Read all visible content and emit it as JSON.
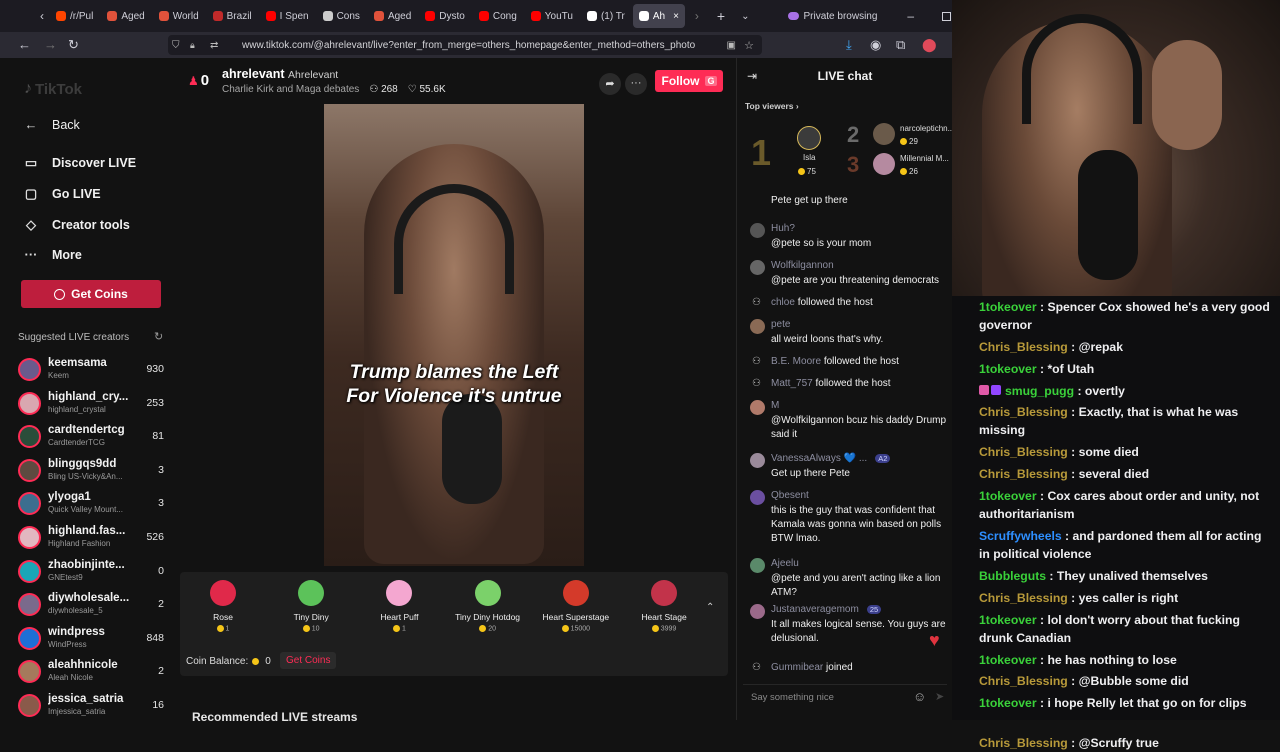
{
  "browser": {
    "tabs": [
      {
        "label": "/r/Pul",
        "color": "#ff4500"
      },
      {
        "label": "Aged",
        "color": "#e0523b"
      },
      {
        "label": "World",
        "color": "#e0523b"
      },
      {
        "label": "Brazil",
        "color": "#c02a2a"
      },
      {
        "label": "I Spen",
        "color": "#ff0000"
      },
      {
        "label": "Cons",
        "color": "#cccccc"
      },
      {
        "label": "Aged",
        "color": "#e0523b"
      },
      {
        "label": "Dysto",
        "color": "#ff0000"
      },
      {
        "label": "Cong",
        "color": "#ff0000"
      },
      {
        "label": "YouTu",
        "color": "#ff0000"
      },
      {
        "label": "(1) Tr",
        "color": "#ffffff"
      },
      {
        "label": "Ah",
        "color": "#ffffff"
      }
    ],
    "private_label": "Private browsing",
    "url": "www.tiktok.com/@ahrelevant/live?enter_from_merge=others_homepage&enter_method=others_photo"
  },
  "sidebar": {
    "logo": "TikTok",
    "back": "Back",
    "items": [
      {
        "label": "Discover LIVE",
        "icon": "tv-icon"
      },
      {
        "label": "Go LIVE",
        "icon": "camera-icon"
      },
      {
        "label": "Creator tools",
        "icon": "lightbulb-icon"
      },
      {
        "label": "More",
        "icon": "more-icon"
      }
    ],
    "get_coins": "Get Coins",
    "suggested_title": "Suggested LIVE creators",
    "creators": [
      {
        "name": "keemsama",
        "sub": "Keem",
        "count": "930",
        "color": "#6a5a8c"
      },
      {
        "name": "highland_cry...",
        "sub": "highland_crystal",
        "count": "253",
        "color": "#d9a7b0"
      },
      {
        "name": "cardtendertcg",
        "sub": "CardtenderTCG",
        "count": "81",
        "color": "#2a4d3a"
      },
      {
        "name": "blinggqs9dd",
        "sub": "Bling US-Vicky&An...",
        "count": "3",
        "color": "#5d4a40"
      },
      {
        "name": "ylyoga1",
        "sub": "Quick Valley Mount...",
        "count": "3",
        "color": "#3c6e8f"
      },
      {
        "name": "highland.fas...",
        "sub": "Highland Fashion",
        "count": "526",
        "color": "#e2b7c0"
      },
      {
        "name": "zhaobinjinte...",
        "sub": "GNEtest9",
        "count": "0",
        "color": "#1aa6b7"
      },
      {
        "name": "diywholesale...",
        "sub": "diywholesale_5",
        "count": "2",
        "color": "#7a6a8c"
      },
      {
        "name": "windpress",
        "sub": "WindPress",
        "count": "848",
        "color": "#1d6fd6"
      },
      {
        "name": "aleahhnicole",
        "sub": "Aleah Nicole",
        "count": "2",
        "color": "#a57a5c"
      },
      {
        "name": "jessica_satria",
        "sub": "Imjessica_satria",
        "count": "16",
        "color": "#8a5a4a"
      }
    ]
  },
  "live": {
    "rank": "0",
    "username": "ahrelevant",
    "display_name": "Ahrelevant",
    "topic": "Charlie Kirk and Maga debates",
    "viewers": "268",
    "likes": "55.6K",
    "follow": "Follow",
    "follow_badge": "G",
    "caption_line1": "Trump blames the Left",
    "caption_line2": "For Violence it's untrue"
  },
  "gifts": [
    {
      "name": "Rose",
      "price": "1",
      "color": "#e0294a"
    },
    {
      "name": "Tiny Diny",
      "price": "10",
      "color": "#5cc25a"
    },
    {
      "name": "Heart Puff",
      "price": "1",
      "color": "#f4a7d0"
    },
    {
      "name": "Tiny Diny Hotdog",
      "price": "20",
      "color": "#7bd16a"
    },
    {
      "name": "Heart Superstage",
      "price": "15000",
      "color": "#d43a2a"
    },
    {
      "name": "Heart Stage",
      "price": "3999",
      "color": "#c2334a"
    }
  ],
  "coin_balance_label": "Coin Balance:",
  "coin_balance": "0",
  "get_coins_link": "Get Coins",
  "recommended": "Recommended LIVE streams",
  "chat": {
    "title": "LIVE chat",
    "top_viewers": "Top viewers",
    "top": [
      {
        "rank": "1",
        "name": "Isla",
        "coins": "75"
      },
      {
        "rank": "2",
        "name": "narcoleptichn...",
        "coins": "29"
      },
      {
        "rank": "3",
        "name": "Millennial M...",
        "coins": "26"
      }
    ],
    "messages": [
      {
        "user": "",
        "text": "Pete get up there",
        "color": "#777"
      },
      {
        "user": "Huh?",
        "text": "@pete so is your mom",
        "color": "#555"
      },
      {
        "user": "Wolfkilgannon",
        "text": "@pete are you threatening democrats",
        "color": "#666"
      },
      {
        "user": "chloe",
        "text": "followed the host",
        "inline": true
      },
      {
        "user": "pete",
        "text": "all weird loons that's why.",
        "color": "#8a6a55"
      },
      {
        "user": "B.E. Moore",
        "text": "followed the host",
        "inline": true
      },
      {
        "user": "Matt_757",
        "text": "followed the host",
        "inline": true
      },
      {
        "user": "M",
        "text": "@Wolfkilgannon bcuz his daddy Drump said it",
        "color": "#b07a6a"
      },
      {
        "user": "VanessaAlways 💙 ...",
        "text": "Get up there Pete",
        "color": "#9a8a9a",
        "badge": "A2"
      },
      {
        "user": "Qbesent",
        "text": "this is the guy that was confident that Kamala was gonna win based on polls BTW lmao.",
        "color": "#6b4fa0"
      },
      {
        "user": "Ajeelu",
        "text": "@pete and you aren't acting like a lion ATM?",
        "color": "#5a8a6a"
      },
      {
        "user": "Justanaveragemom",
        "text": "It all makes logical sense. You guys are delusional.",
        "color": "#9b6a8a",
        "badge": "25"
      },
      {
        "user": "Gummibear",
        "text": "joined",
        "inline": true
      }
    ],
    "placeholder": "Say something nice"
  },
  "twitch_chat": [
    {
      "user": "1tokeover",
      "color": "#3ad13a",
      "text": "Spencer Cox showed he's a very good governor"
    },
    {
      "user": "Chris_Blessing",
      "color": "#b89a3a",
      "text": "@repak"
    },
    {
      "user": "1tokeover",
      "color": "#3ad13a",
      "text": "*of Utah"
    },
    {
      "user": "smug_pugg",
      "color": "#3ad13a",
      "text": "overtly",
      "badges": true
    },
    {
      "user": "Chris_Blessing",
      "color": "#b89a3a",
      "text": "Exactly, that is what he was missing"
    },
    {
      "user": "Chris_Blessing",
      "color": "#b89a3a",
      "text": "some died"
    },
    {
      "user": "Chris_Blessing",
      "color": "#b89a3a",
      "text": "several died"
    },
    {
      "user": "1tokeover",
      "color": "#3ad13a",
      "text": "Cox cares about order and unity, not authoritarianism"
    },
    {
      "user": "Scruffywheels",
      "color": "#2e8fff",
      "text": "and pardoned them all for acting in political violence"
    },
    {
      "user": "Bubbleguts",
      "color": "#3ad13a",
      "text": "They unalived themselves"
    },
    {
      "user": "Chris_Blessing",
      "color": "#b89a3a",
      "text": "yes caller is right"
    },
    {
      "user": "1tokeover",
      "color": "#3ad13a",
      "text": "lol don't worry about that fucking drunk Canadian"
    },
    {
      "user": "1tokeover",
      "color": "#3ad13a",
      "text": "he has nothing to lose"
    },
    {
      "user": "Chris_Blessing",
      "color": "#b89a3a",
      "text": "@Bubble some did"
    },
    {
      "user": "1tokeover",
      "color": "#3ad13a",
      "text": "i hope Relly let that go on for clips"
    },
    {
      "user": "Chris_Blessing",
      "color": "#b89a3a",
      "text": "@Scruffy true"
    }
  ]
}
